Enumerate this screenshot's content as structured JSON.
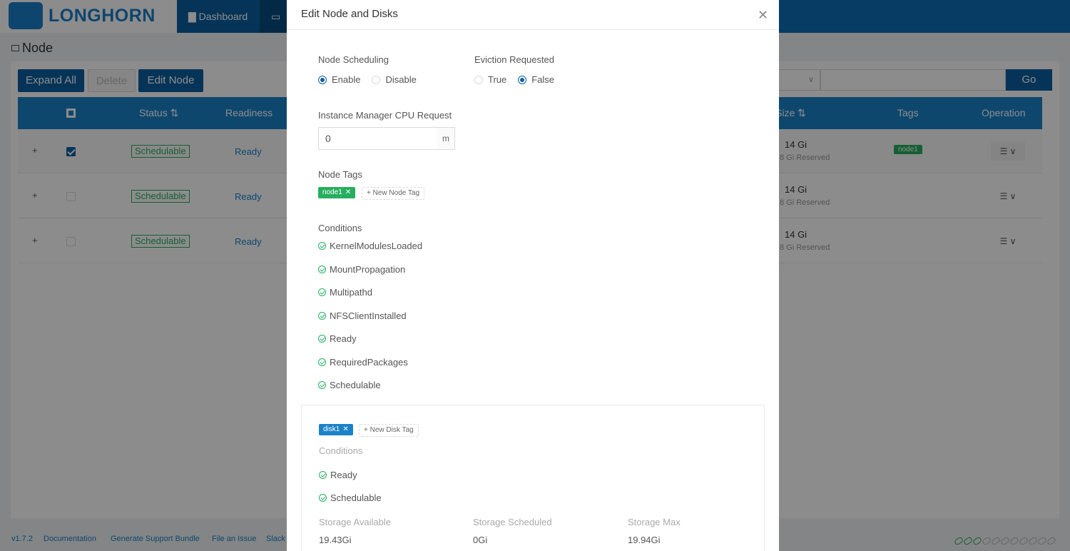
{
  "app": {
    "name": "LONGHORN"
  },
  "nav": {
    "dashboard": "Dashboard"
  },
  "page": {
    "title": "Node"
  },
  "toolbar": {
    "expand_all": "Expand All",
    "delete": "Delete",
    "edit_node": "Edit Node",
    "go": "Go"
  },
  "table": {
    "headers": {
      "status": "Status",
      "readiness": "Readiness",
      "size": "Size",
      "tags": "Tags",
      "operation": "Operation"
    },
    "rows": [
      {
        "status": "Schedulable",
        "readiness": "Ready",
        "size": "14 Gi",
        "reserved": "8 Gi Reserved",
        "tag": "node1",
        "checked": true
      },
      {
        "status": "Schedulable",
        "readiness": "Ready",
        "size": "14 Gi",
        "reserved": "8 Gi Reserved",
        "tag": "",
        "checked": false
      },
      {
        "status": "Schedulable",
        "readiness": "Ready",
        "size": "14 Gi",
        "reserved": "8 Gi Reserved",
        "tag": "",
        "checked": false
      }
    ]
  },
  "footer": {
    "version": "v1.7.2",
    "documentation": "Documentation",
    "support_bundle": "Generate Support Bundle",
    "file_issue": "File an Issue",
    "slack": "Slack"
  },
  "modal": {
    "title": "Edit Node and Disks",
    "node_scheduling": {
      "label": "Node Scheduling",
      "options": [
        "Enable",
        "Disable"
      ],
      "selected": "Enable"
    },
    "eviction_requested": {
      "label": "Eviction Requested",
      "options": [
        "True",
        "False"
      ],
      "selected": "False"
    },
    "cpu_request": {
      "label": "Instance Manager CPU Request",
      "value": "0",
      "unit": "m"
    },
    "node_tags": {
      "label": "Node Tags",
      "tags": [
        "node1"
      ],
      "new_tag": "New Node Tag"
    },
    "conditions": {
      "label": "Conditions",
      "items": [
        "KernelModulesLoaded",
        "MountPropagation",
        "Multipathd",
        "NFSClientInstalled",
        "Ready",
        "RequiredPackages",
        "Schedulable"
      ]
    },
    "disk": {
      "tags": [
        "disk1"
      ],
      "new_tag": "New Disk Tag",
      "conditions_label": "Conditions",
      "conditions": [
        "Ready",
        "Schedulable"
      ],
      "storage_available": {
        "label": "Storage Available",
        "value": "19.43Gi"
      },
      "storage_scheduled": {
        "label": "Storage Scheduled",
        "value": "0Gi"
      },
      "storage_max": {
        "label": "Storage Max",
        "value": "19.94Gi"
      }
    }
  }
}
